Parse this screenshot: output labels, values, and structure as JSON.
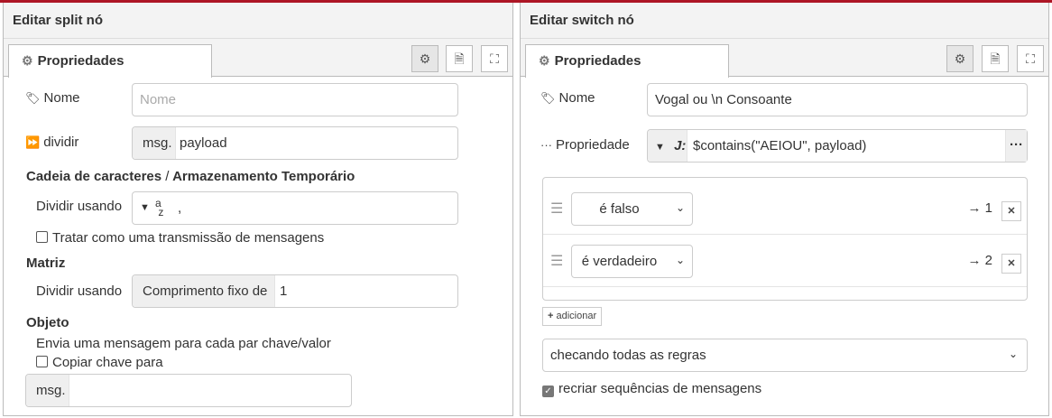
{
  "split": {
    "title": "Editar split nó",
    "tab": "Propriedades",
    "name_label": "Nome",
    "name_placeholder": "Nome",
    "divide_label": "dividir",
    "divide_prefix": "msg.",
    "divide_value": "payload",
    "string_section": "Cadeia de caracteres",
    "string_section_sep": "/",
    "buffer_section": "Armazenamento Temporário",
    "split_using_label": "Dividir usando",
    "split_using_value": ",",
    "stream_label": "Tratar como uma transmissão de mensagens",
    "array_section": "Matriz",
    "array_split_label": "Dividir usando",
    "array_fixed_label": "Comprimento fixo de",
    "array_fixed_value": "1",
    "object_section": "Objeto",
    "object_desc": "Envia uma mensagem para cada par chave/valor",
    "copy_key_label": "Copiar chave para",
    "copy_key_prefix": "msg."
  },
  "switch": {
    "title": "Editar switch nó",
    "tab": "Propriedades",
    "name_label": "Nome",
    "name_value": "Vogal ou \\n Consoante",
    "property_label": "Propriedade",
    "property_value": "$contains(\"AEIOU\", payload)",
    "rules": [
      {
        "op": "é falso",
        "output": "→ 1"
      },
      {
        "op": "é verdadeiro",
        "output": "→ 2"
      }
    ],
    "add_button": "adicionar",
    "check_mode": "checando todas as regras",
    "recreate_label": "recriar sequências de mensagens"
  }
}
